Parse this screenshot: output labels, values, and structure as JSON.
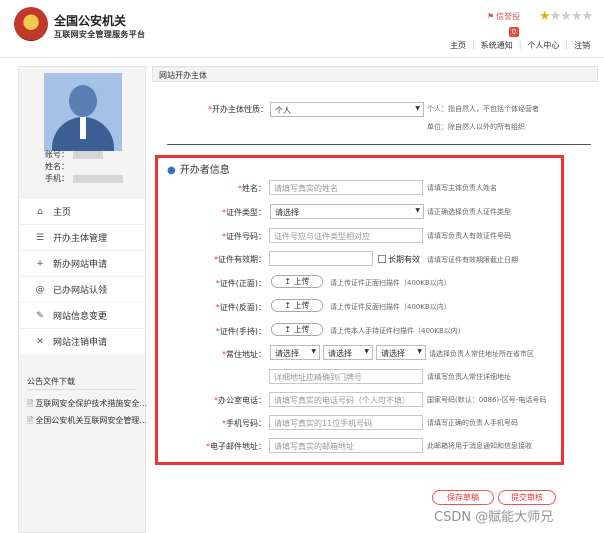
{
  "header": {
    "title": "全国公安机关",
    "subtitle": "互联网安全管理服务平台",
    "complaint": "信誉投",
    "badge": "0",
    "nav": [
      "主页",
      "系统通知",
      "个人中心",
      "注销"
    ],
    "stars_filled": 1,
    "stars_total": 5
  },
  "sidebar": {
    "account_label": "账号：",
    "name_label": "姓名：",
    "phone_label": "手机：",
    "menu": [
      {
        "label": "主页",
        "icon": "home-icon"
      },
      {
        "label": "开办主体管理",
        "icon": "menu-icon"
      },
      {
        "label": "新办网站申请",
        "icon": "plus-icon"
      },
      {
        "label": "已办网站认领",
        "icon": "at-icon"
      },
      {
        "label": "网站信息变更",
        "icon": "edit-icon"
      },
      {
        "label": "网站注销申请",
        "icon": "close-icon"
      }
    ],
    "announcements_title": "公告文件下载",
    "announcements": [
      "互联网安全保护技术措施安全...",
      "全国公安机关互联网安全管理..."
    ]
  },
  "main": {
    "section_header": "网站开办主体",
    "entity_type": {
      "label": "开办主体性质：",
      "value": "个人",
      "hint1": "个人：指自然人，不包括个体经营者",
      "hint2": "单位：除自然人以外的所有组织"
    },
    "organizer": {
      "title": "开办者信息",
      "name": {
        "label": "姓名：",
        "placeholder": "请填写真实的姓名",
        "hint": "请填写主体负责人姓名"
      },
      "id_type": {
        "label": "证件类型：",
        "value": "请选择",
        "hint": "请正确选择负责人证件类型"
      },
      "id_number": {
        "label": "证件号码：",
        "placeholder": "证件号应与证件类型相对应",
        "hint": "请填写负责人有效证件号码"
      },
      "id_valid": {
        "label": "证件有效期：",
        "checkbox_label": "长期有效",
        "hint": "请填写证件有效期限截止日期"
      },
      "id_front": {
        "label": "证件(正面)：",
        "button": "上传",
        "hint": "请上传证件正面扫描件（400KB以内）"
      },
      "id_back": {
        "label": "证件(反面)：",
        "button": "上传",
        "hint": "请上传证件反面扫描件（400KB以内）"
      },
      "id_hand": {
        "label": "证件(手持)：",
        "button": "上传",
        "hint": "请上传本人手持证件扫描件（400KB以内）"
      },
      "address": {
        "label": "常住地址：",
        "selects": [
          "请选择",
          "请选择",
          "请选择"
        ],
        "hint": "请选择负责人常住地址所在省市区",
        "detail_placeholder": "详细地址应精确到门牌号",
        "detail_hint": "请填写负责人常住详细地址"
      },
      "office_phone": {
        "label": "办公室电话：",
        "placeholder": "请填写真实的电话号码（个人可不填）",
        "hint": "国家号码(默认：0086)-区号-电话号码"
      },
      "mobile": {
        "label": "手机号码：",
        "placeholder": "请填写真实的11位手机号码",
        "hint": "请填写正确的负责人手机号码"
      },
      "email": {
        "label": "电子邮件地址：",
        "placeholder": "请填写真实的邮箱地址",
        "hint": "此邮箱将用于消息通知和信息接收"
      }
    },
    "buttons": {
      "save": "保存草稿",
      "submit": "提交审核"
    }
  },
  "watermark": "CSDN @赋能大师兄"
}
